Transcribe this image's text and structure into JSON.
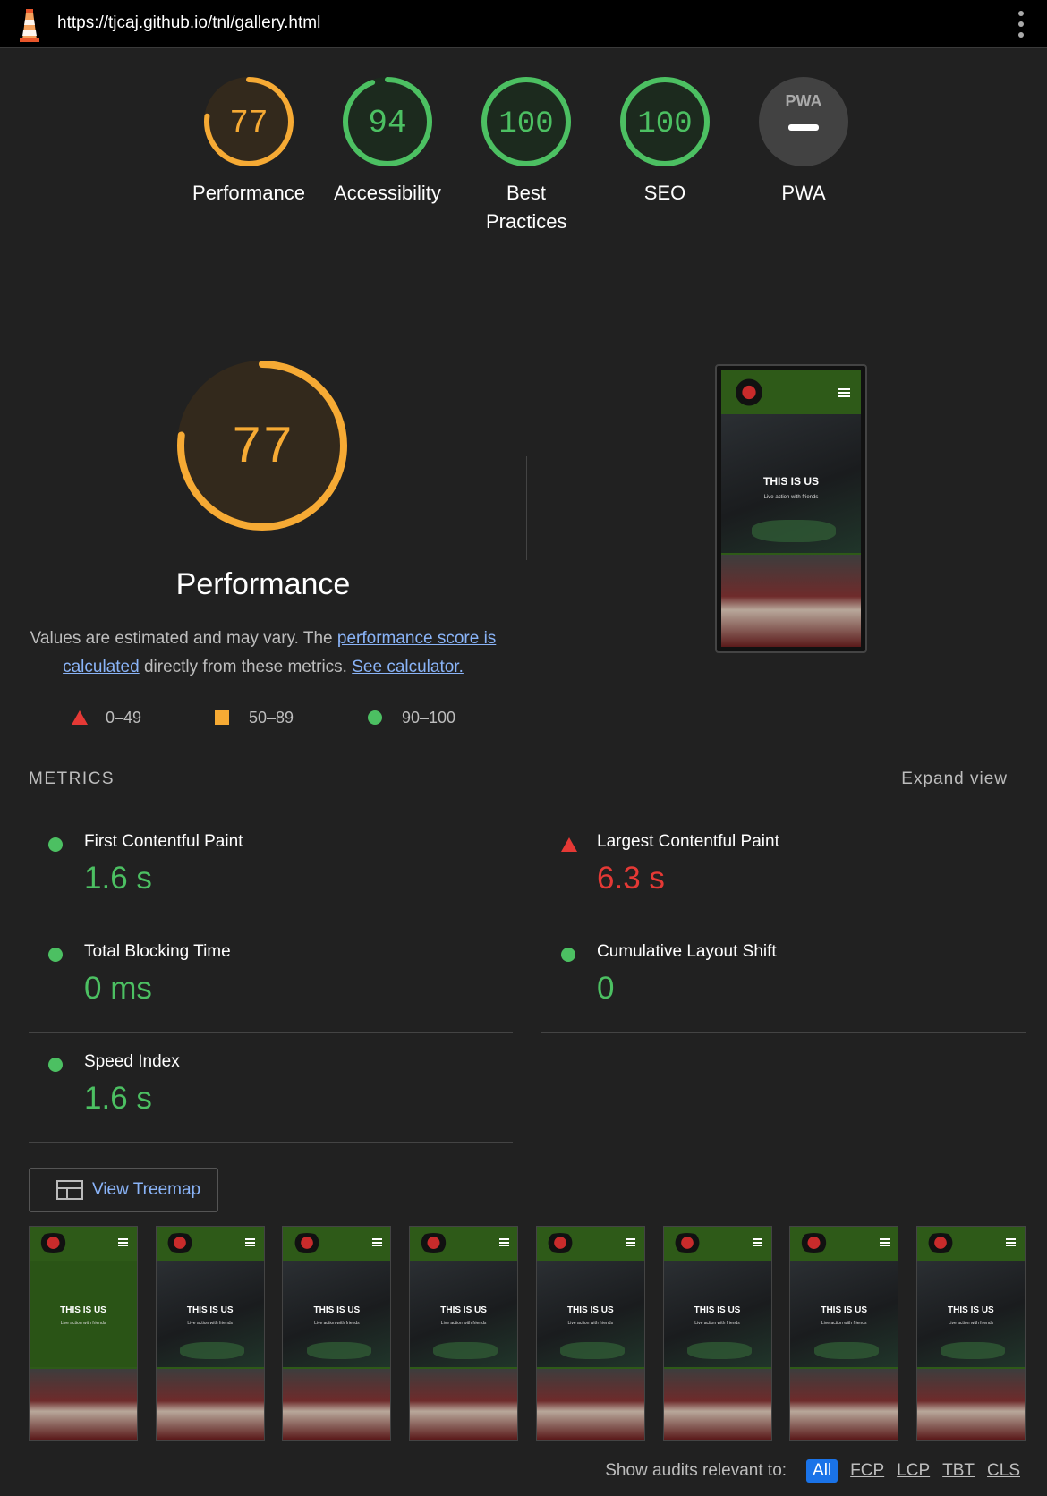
{
  "browser": {
    "url": "https://tjcaj.github.io/tnl/gallery.html"
  },
  "summary": {
    "gauges": [
      {
        "score": "77",
        "label": "Performance",
        "color": "#f6aa34",
        "fraction": 0.77
      },
      {
        "score": "94",
        "label": "Accessibility",
        "color": "#4cc062",
        "fraction": 0.94
      },
      {
        "score": "100",
        "label": "Best Practices",
        "color": "#4cc062",
        "fraction": 1.0
      },
      {
        "score": "100",
        "label": "SEO",
        "color": "#4cc062",
        "fraction": 1.0
      },
      {
        "score": "PWA",
        "label": "PWA",
        "color": "#3b3b3b",
        "fraction": 0
      }
    ]
  },
  "performance": {
    "score": "77",
    "fraction": 0.77,
    "title": "Performance",
    "desc_prefix": "Values are estimated and may vary. The ",
    "desc_link1": "performance score is calculated",
    "desc_middle": " directly from these metrics. ",
    "desc_link2": "See calculator.",
    "legend": {
      "fail": "0–49",
      "average": "50–89",
      "pass": "90–100"
    }
  },
  "screenshot": {
    "title": "THIS IS US",
    "subtitle": "Live action with friends"
  },
  "metrics": {
    "header": "METRICS",
    "expand": "Expand view",
    "items": [
      {
        "name": "First Contentful Paint",
        "value": "1.6 s",
        "status": "pass"
      },
      {
        "name": "Largest Contentful Paint",
        "value": "6.3 s",
        "status": "fail"
      },
      {
        "name": "Total Blocking Time",
        "value": "0 ms",
        "status": "pass"
      },
      {
        "name": "Cumulative Layout Shift",
        "value": "0",
        "status": "pass"
      },
      {
        "name": "Speed Index",
        "value": "1.6 s",
        "status": "pass"
      }
    ]
  },
  "treemap": {
    "label": "View Treemap"
  },
  "filmstrip": {
    "frame_title": "THIS IS US",
    "frame_subtitle": "Live action with friends"
  },
  "filter": {
    "label": "Show audits relevant to:",
    "options": [
      "All",
      "FCP",
      "LCP",
      "TBT",
      "CLS"
    ]
  },
  "colors": {
    "pass": "#4cc062",
    "average": "#f6aa34",
    "fail": "#e53935",
    "link": "#8ab4f8"
  }
}
